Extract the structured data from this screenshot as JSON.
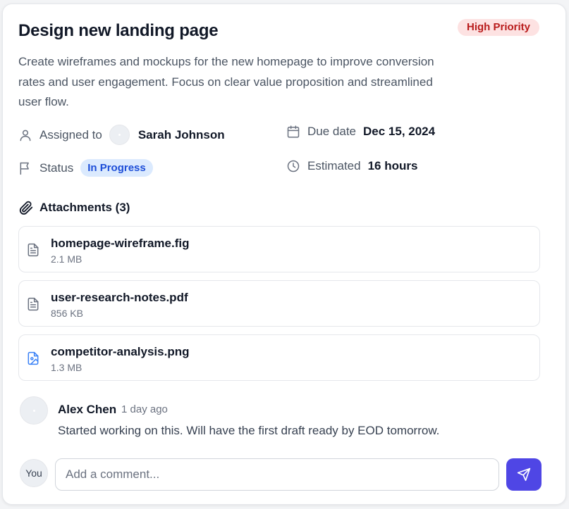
{
  "task": {
    "title": "Design new landing page",
    "priority": "High Priority",
    "description": "Create wireframes and mockups for the new homepage to improve conversion rates and user engagement. Focus on clear value proposition and streamlined user flow."
  },
  "meta": {
    "assigned_label": "Assigned to",
    "assignee": "Sarah Johnson",
    "due_label": "Due date",
    "due_date": "Dec 15, 2024",
    "status_label": "Status",
    "status": "In Progress",
    "estimated_label": "Estimated",
    "estimated": "16 hours"
  },
  "attachments": {
    "title": "Attachments (3)",
    "items": [
      {
        "name": "homepage-wireframe.fig",
        "size": "2.1 MB",
        "icon": "file-text-icon"
      },
      {
        "name": "user-research-notes.pdf",
        "size": "856 KB",
        "icon": "file-text-icon"
      },
      {
        "name": "competitor-analysis.png",
        "size": "1.3 MB",
        "icon": "file-image-icon"
      }
    ]
  },
  "comments": [
    {
      "author": "Alex Chen",
      "time": "1 day ago",
      "text": "Started working on this. Will have the first draft ready by EOD tomorrow."
    }
  ],
  "composer": {
    "avatar_label": "You",
    "placeholder": "Add a comment...",
    "send_icon": "send-icon"
  },
  "colors": {
    "accent": "#4f46e5",
    "priority_bg": "#fde2e2",
    "priority_text": "#b91c1c",
    "status_bg": "#dbeafe",
    "status_text": "#1d4ed8",
    "image_icon": "#3b82f6"
  }
}
